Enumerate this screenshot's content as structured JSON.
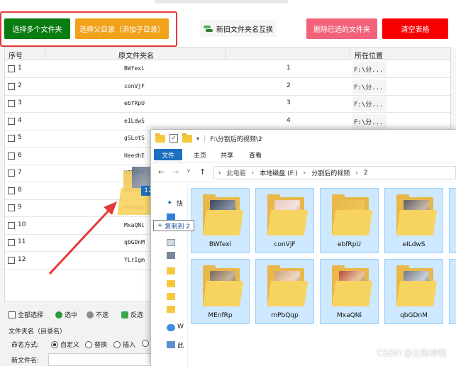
{
  "toolbar": {
    "select_multi_label": "选择多个文件夹",
    "select_parent_label": "选择父目录（添加子目录）",
    "swap_label": "新旧文件夹名互换",
    "delete_selected_label": "删除已选的文件夹",
    "clear_table_label": "清空表格"
  },
  "table": {
    "headers": {
      "index": "序号",
      "original_name": "原文件夹名",
      "location": "所在位置"
    },
    "rows": [
      {
        "index": "1",
        "name": "BWfexi",
        "num": "1",
        "location": "F:\\分..."
      },
      {
        "index": "2",
        "name": "conVjF",
        "num": "2",
        "location": "F:\\分..."
      },
      {
        "index": "3",
        "name": "ebfRpU",
        "num": "3",
        "location": "F:\\分..."
      },
      {
        "index": "4",
        "name": "eILdwS",
        "num": "4",
        "location": "F:\\分..."
      },
      {
        "index": "5",
        "name": "gSLotS",
        "num": "",
        "location": ""
      },
      {
        "index": "6",
        "name": "HeedhE",
        "num": "",
        "location": ""
      },
      {
        "index": "7",
        "name": "HIYZHQ",
        "num": "",
        "location": ""
      },
      {
        "index": "8",
        "name": "MEnfRp",
        "num": "",
        "location": ""
      },
      {
        "index": "9",
        "name": "mPbQqp",
        "num": "",
        "location": ""
      },
      {
        "index": "10",
        "name": "MxaQNi",
        "num": "",
        "location": ""
      },
      {
        "index": "11",
        "name": "qbGDnM",
        "num": "",
        "location": ""
      },
      {
        "index": "12",
        "name": "YLrIgm",
        "num": "",
        "location": ""
      }
    ]
  },
  "bottom": {
    "select_all": "全部选择",
    "select": "选中",
    "deselect": "不选",
    "invert": "反选",
    "section_title": "文件夹名（目录名）",
    "naming_mode_label": "命名方式:",
    "mode_custom": "自定义",
    "mode_replace": "替换",
    "mode_insert": "插入",
    "new_name_label": "新文件名:"
  },
  "explorer": {
    "title_path": "F:\\分割后的视频\\2",
    "tabs": [
      "文件",
      "主页",
      "共享",
      "查看"
    ],
    "breadcrumb": [
      "此电脑",
      "本地磁盘 (F:)",
      "分割后的视频",
      "2"
    ],
    "folders": [
      "BWfexi",
      "conVjF",
      "ebfRpU",
      "eILdwS",
      "",
      "MEnfRp",
      "mPbQqp",
      "MxaQNi",
      "qbGDnM",
      ""
    ],
    "nav_letters": [
      "快",
      "W",
      "此"
    ]
  },
  "drag": {
    "badge_count": "12",
    "tooltip_text": "复制到 2"
  },
  "watermark": "CSDN @尘隐神明",
  "colors": {
    "green": "#0a7d12",
    "orange": "#f0a21b",
    "pink": "#f2627a",
    "red": "#f80000",
    "selection": "#cde8ff",
    "arrow": "#e53935"
  }
}
